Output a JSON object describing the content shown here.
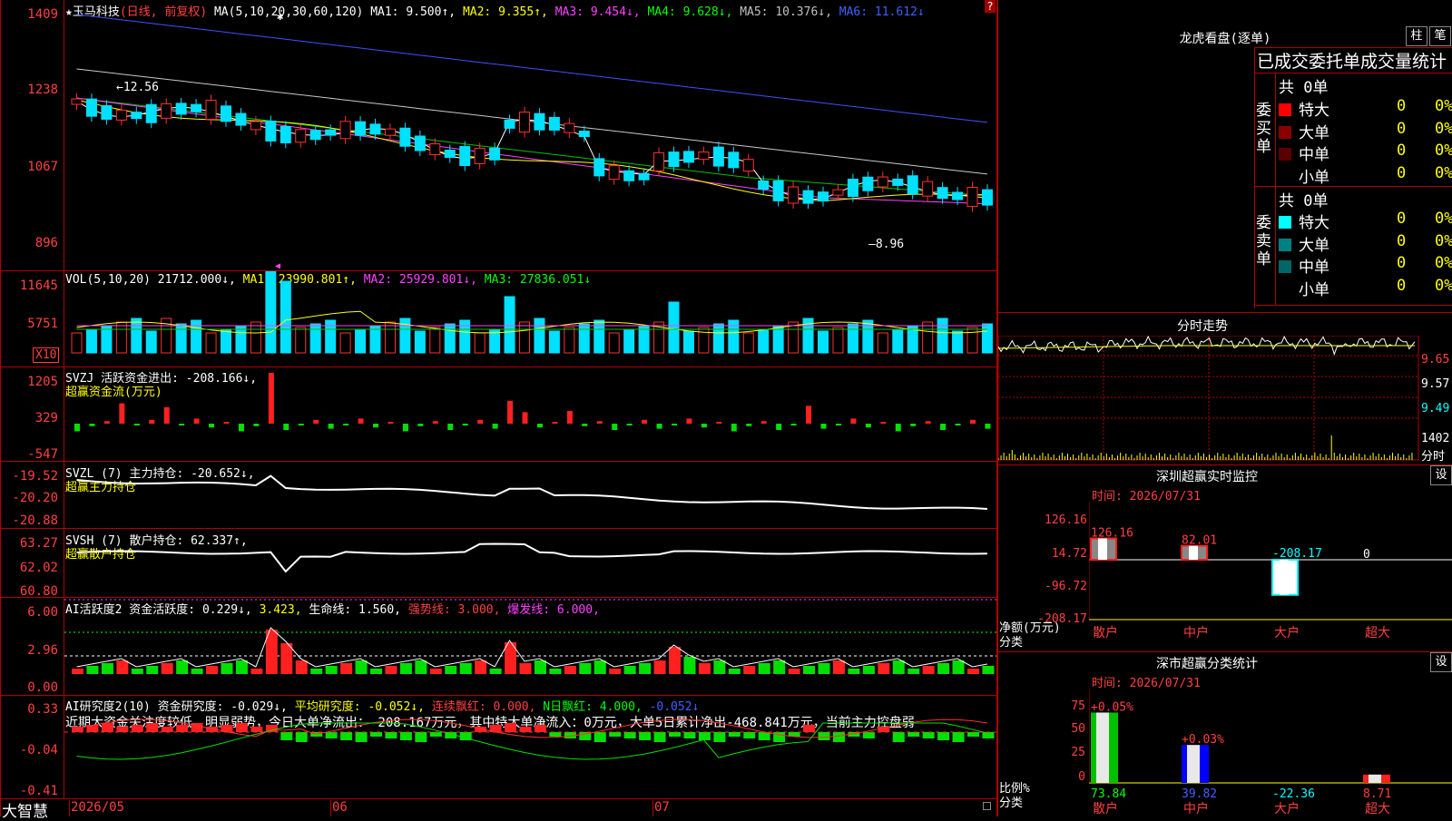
{
  "main_chart": {
    "header": {
      "star": "★",
      "stock_name": "玉马科技",
      "mode": "(日线, 前复权)",
      "ma_params": "MA(5,10,20,30,60,120)",
      "ma1": "MA1: 9.500↑,",
      "ma2": "MA2: 9.355↑,",
      "ma3": "MA3: 9.454↓,",
      "ma4": "MA4: 9.628↓,",
      "ma5": "MA5: 10.376↓,",
      "ma6": "MA6: 11.612↓"
    },
    "yticks": [
      "1409",
      "1238",
      "1067",
      "896"
    ],
    "high_label": "12.56",
    "low_label": "8.96",
    "corner_mark": "?"
  },
  "vol_panel": {
    "header": {
      "label": "VOL(5,10,20)",
      "value": "21712.000↓,",
      "ma1": "MA1: 23990.801↑,",
      "ma2": "MA2: 25929.801↓,",
      "ma3": "MA3: 27836.051↓"
    },
    "yticks": [
      "11645",
      "5751"
    ],
    "unit": "X10"
  },
  "svzj_panel": {
    "header": {
      "label": "SVZJ  活跃资金进出: -208.166↓,",
      "subtitle": "超赢资金流(万元)"
    },
    "yticks": [
      "1205",
      "329",
      "-547"
    ]
  },
  "svzl_panel": {
    "header": {
      "label": "SVZL (7) 主力持仓: -20.652↓,",
      "subtitle": "超赢主力持仓"
    },
    "yticks": [
      "-19.52",
      "-20.20",
      "-20.88"
    ]
  },
  "svsh_panel": {
    "header": {
      "label": "SVSH (7) 散户持仓: 62.337↑,",
      "subtitle": "超赢散户持仓"
    },
    "yticks": [
      "63.27",
      "62.02",
      "60.80"
    ]
  },
  "ai_active_panel": {
    "header": {
      "p1": "AI活跃度2 资金活跃度: 0.229↓,",
      "p2": "3.423,",
      "p3": "生命线: 1.560,",
      "p4": "强势线: 3.000,",
      "p5": "爆发线: 6.000,"
    },
    "yticks": [
      "6.00",
      "2.96",
      "0.00"
    ]
  },
  "ai_research_panel": {
    "header": {
      "p1": "AI研究度2(10) 资金研究度: -0.029↓,",
      "p2": "平均研究度: -0.052↓,",
      "p3": "连续飘红: 0.000,",
      "p4": "N日飘红: 4.000,",
      "p5": "-0.052↓"
    },
    "summary": "近期大资金关注度较低，明显弱势，今日大单净流出：-208.167万元，其中特大单净流入：0万元，大单5日累计净出-468.841万元，当前主力控盘弱",
    "yticks": [
      "0.33",
      "-0.04",
      "-0.41"
    ]
  },
  "bottom_axis": {
    "brand": "大智慧",
    "labels": [
      "2026/05",
      "06",
      "07"
    ]
  },
  "right_panel": {
    "dragon_title": "龙虎看盘(逐单)",
    "btn_column": "柱",
    "btn_pen": "笔",
    "stat_tabs": "已成交委托单成交量统计",
    "buy_label": "委买单",
    "sell_label": "委卖单",
    "buy_total": "共 0单",
    "sell_total": "共 0单",
    "buy_rows": [
      {
        "name": "特大",
        "count": "0",
        "pct": "0%",
        "color": "#ff0000"
      },
      {
        "name": "大单",
        "count": "0",
        "pct": "0%",
        "color": "#8a0000"
      },
      {
        "name": "中单",
        "count": "0",
        "pct": "0%",
        "color": "#5a0000"
      },
      {
        "name": "小单",
        "count": "0",
        "pct": "0%",
        "color": ""
      }
    ],
    "sell_rows": [
      {
        "name": "特大",
        "count": "0",
        "pct": "0%",
        "color": "#00ffff"
      },
      {
        "name": "大单",
        "count": "0",
        "pct": "0%",
        "color": "#008080"
      },
      {
        "name": "中单",
        "count": "0",
        "pct": "0%",
        "color": "#006666"
      },
      {
        "name": "小单",
        "count": "0",
        "pct": "0%",
        "color": ""
      }
    ],
    "intraday_title": "分时走势",
    "intraday_yticks": [
      "9.65",
      "9.57",
      "9.49",
      "1402"
    ],
    "intraday_vol_unit": "分时",
    "monitor_title": "深圳超赢实时监控",
    "monitor_settings": "设",
    "monitor_time": "时间: 2026/07/31",
    "monitor_yticks": [
      "126.16",
      "14.72",
      "-96.72",
      "-208.17"
    ],
    "monitor_ylabel": "净额(万元)",
    "monitor_xlabel": "分类",
    "monitor_categories": [
      "散户",
      "中户",
      "大户",
      "超大"
    ],
    "monitor_values": [
      126.16,
      82.01,
      -208.17,
      0
    ],
    "monitor_value_labels": [
      "126.16",
      "82.01",
      "-208.17",
      "0"
    ],
    "classify_title": "深市超赢分类统计",
    "classify_settings": "设",
    "classify_time": "时间: 2026/07/31",
    "classify_yticks": [
      "75",
      "50",
      "25",
      "0"
    ],
    "classify_ylabel": "比例%",
    "classify_xlabel": "分类",
    "classify_categories": [
      "散户",
      "中户",
      "大户",
      "超大"
    ],
    "classify_values": [
      73.84,
      39.82,
      -22.36,
      8.71
    ],
    "classify_value_labels": [
      "73.84",
      "39.82",
      "-22.36",
      "8.71"
    ],
    "classify_top_labels": [
      "+0.05%",
      "+0.03%"
    ]
  }
}
